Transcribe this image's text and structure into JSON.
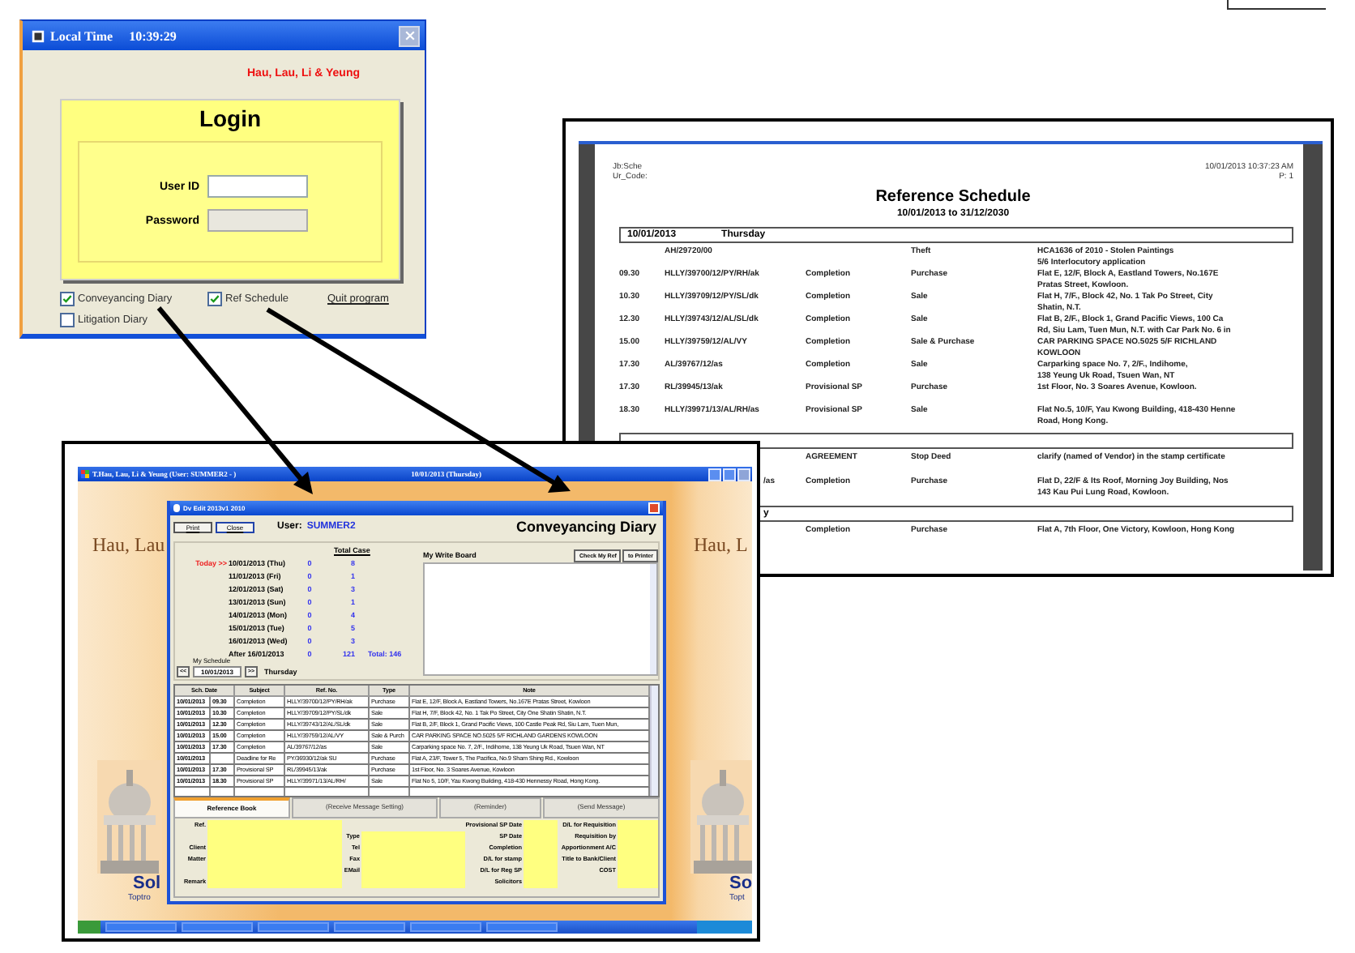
{
  "login_window": {
    "title": "Local Time",
    "time": "10:39:29",
    "firm": "Hau, Lau, Li & Yeung",
    "heading": "Login",
    "fields": [
      {
        "label": "User ID",
        "disabled": false
      },
      {
        "label": "Password",
        "disabled": true
      }
    ],
    "options": [
      {
        "label": "Conveyancing Diary",
        "checked": true
      },
      {
        "label": "Ref Schedule",
        "checked": true
      },
      {
        "label": "Litigation Diary",
        "checked": false
      }
    ],
    "quit_link": "Quit program"
  },
  "report": {
    "header_left": [
      "Jb:Sche",
      "Ur_Code:"
    ],
    "header_right": [
      "10/01/2013 10:37:23 AM",
      "P:   1"
    ],
    "title": "Reference Schedule",
    "range": "10/01/2013  to  31/12/2030",
    "groups": [
      {
        "kind": "header",
        "date": "10/01/2013",
        "day": "Thursday",
        "rows": [
          {
            "kind": "entry",
            "ref": "AH/29720/00",
            "type": "Theft",
            "note_lines": [
              "HCA1636 of 2010 - Stolen Paintings",
              "5/6  Interlocutory application"
            ]
          },
          {
            "kind": "entry",
            "time": "09.30",
            "ref": "HLLY/39700/12/PY/RH/ak",
            "subject": "Completion",
            "type": "Purchase",
            "note_lines": [
              "Flat E, 12/F, Block A, Eastland Towers, No.167E",
              "Pratas Street, Kowloon."
            ]
          },
          {
            "kind": "entry",
            "time": "10.30",
            "ref": "HLLY/39709/12/PY/SL/dk",
            "subject": "Completion",
            "type": "Sale",
            "note_lines": [
              "Flat H, 7/F., Block 42, No. 1 Tak Po Street, City",
              "Shatin, N.T."
            ]
          },
          {
            "kind": "entry",
            "time": "12.30",
            "ref": "HLLY/39743/12/AL/SL/dk",
            "subject": "Completion",
            "type": "Sale",
            "note_lines": [
              "Flat B, 2/F., Block 1, Grand Pacific Views, 100 Ca",
              "Rd, Siu Lam, Tuen Mun, N.T. with Car Park No. 6 in"
            ]
          },
          {
            "kind": "entry",
            "time": "15.00",
            "ref": "HLLY/39759/12/AL/VY",
            "subject": "Completion",
            "type": "Sale & Purchase",
            "note_lines": [
              "CAR PARKING SPACE NO.5025 5/F RICHLAND",
              "KOWLOON"
            ]
          },
          {
            "kind": "entry",
            "time": "17.30",
            "ref": "AL/39767/12/as",
            "subject": "Completion",
            "type": "Sale",
            "note_lines": [
              "Carparking space No. 7, 2/F., Indihome,",
              "138 Yeung Uk Road, Tsuen Wan, NT"
            ]
          },
          {
            "kind": "entry",
            "time": "17.30",
            "ref": "RL/39945/13/ak",
            "subject": "Provisional SP",
            "type": "Purchase",
            "note_lines": [
              "1st Floor, No. 3 Soares Avenue, Kowloon."
            ]
          },
          {
            "kind": "entry",
            "time": "18.30",
            "ref": "HLLY/39971/13/AL/RH/as",
            "subject": "Provisional SP",
            "type": "Sale",
            "note_lines": [
              "Flat No.5, 10/F, Yau Kwong Building, 418-430 Henne",
              "Road, Hong Kong."
            ]
          }
        ]
      },
      {
        "kind": "covered",
        "rows": [
          {
            "kind": "covered",
            "subject": "AGREEMENT",
            "type": "Stop Deed",
            "note_lines": [
              "clarify (named of Vendor) in the stamp certificate"
            ]
          },
          {
            "kind": "covered",
            "ref": "/as",
            "subject": "Completion",
            "type": "Purchase",
            "note_lines": [
              "Flat D, 22/F & Its Roof, Morning Joy Building, Nos",
              "143 Kau Pui Lung Road, Kowloon."
            ]
          }
        ]
      },
      {
        "kind": "covered",
        "day": "y",
        "rows": [
          {
            "kind": "covered",
            "subject": "Completion",
            "type": "Purchase",
            "note_lines": [
              "Flat A, 7th Floor, One Victory, Kowloon, Hong Kong"
            ]
          }
        ]
      }
    ]
  },
  "desktop": {
    "title": "T.Hau, Lau, Li & Yeung  (User: SUMMER2 - )",
    "date": "10/01/2013  (Thursday)",
    "backdrop": [
      "Hau, Lau",
      "Hau, L"
    ],
    "brands": [
      {
        "name": "Sol",
        "tagline": "Toptro"
      },
      {
        "name": "So",
        "tagline": "Topt"
      }
    ]
  },
  "diary_window": {
    "title": "Dv Edit 2013v1 2010",
    "buttons": [
      "Print",
      "Close"
    ],
    "user_label": "User:",
    "user": "SUMMER2",
    "heading": "Conveyancing Diary",
    "summary_header": "Total Case",
    "today_marker": "Today >>",
    "days": [
      {
        "date": "10/01/2013 (Thu)",
        "count": "0",
        "total": "8",
        "today": true
      },
      {
        "date": "11/01/2013 (Fri)",
        "count": "0",
        "total": "1",
        "today": false
      },
      {
        "date": "12/01/2013 (Sat)",
        "count": "0",
        "total": "3",
        "today": false
      },
      {
        "date": "13/01/2013 (Sun)",
        "count": "0",
        "total": "1",
        "today": false
      },
      {
        "date": "14/01/2013 (Mon)",
        "count": "0",
        "total": "4",
        "today": false
      },
      {
        "date": "15/01/2013 (Tue)",
        "count": "0",
        "total": "5",
        "today": false
      },
      {
        "date": "16/01/2013 (Wed)",
        "count": "0",
        "total": "3",
        "today": false
      },
      {
        "date": "After 16/01/2013",
        "count": "0",
        "total": "121",
        "today": false
      }
    ],
    "grand_total": "Total: 146",
    "schedule_label": "My Schedule",
    "nav": {
      "prev": "<<",
      "date": "10/01/2013",
      "next": ">>",
      "day": "Thursday"
    },
    "board": {
      "title": "My Write Board",
      "buttons": [
        "Check My Ref",
        "to Printer"
      ]
    },
    "table": {
      "columns": [
        "Sch. Date",
        "Subject",
        "Ref. No.",
        "Type",
        "Note"
      ],
      "rows": [
        {
          "date": "10/01/2013",
          "time": "09.30",
          "subject": "Completion",
          "ref": "HLLY/39700/12/PY/RH/ak",
          "type": "Purchase",
          "note": "Flat E, 12/F, Block A, Eastland Towers, No.167E Pratas Street, Kowloon"
        },
        {
          "date": "10/01/2013",
          "time": "10.30",
          "subject": "Completion",
          "ref": "HLLY/39709/12/PY/SL/dk",
          "type": "Sale",
          "note": "Flat H, 7/F, Block 42, No. 1 Tak Po Street, City One Shatin Shatin, N.T."
        },
        {
          "date": "10/01/2013",
          "time": "12.30",
          "subject": "Completion",
          "ref": "HLLY/39743/12/AL/SL/dk",
          "type": "Sale",
          "note": "Flat B, 2/F, Block 1, Grand Pacific Views, 100 Castle Peak Rd, Siu Lam, Tuen Mun,"
        },
        {
          "date": "10/01/2013",
          "time": "15.00",
          "subject": "Completion",
          "ref": "HLLY/39759/12/AL/VY",
          "type": "Sale & Purch",
          "note": "CAR PARKING SPACE NO.5025 5/F RICHLAND GARDENS KOWLOON"
        },
        {
          "date": "10/01/2013",
          "time": "17.30",
          "subject": "Completion",
          "ref": "AL/39767/12/as",
          "type": "Sale",
          "note": "Carparking space No. 7, 2/F., Indihome, 138 Yeung Uk Road, Tsuen Wan, NT"
        },
        {
          "date": "10/01/2013",
          "subject": "Deadline for Re",
          "ref": "PY/36930/12/ak SU",
          "type": "Purchase",
          "note": "Flat A, 23/F, Tower 5, The Pacifica, No.9 Sham Shing Rd., Kowloon"
        },
        {
          "date": "10/01/2013",
          "time": "17.30",
          "subject": "Provisional SP",
          "ref": "RL/39945/13/ak",
          "type": "Purchase",
          "note": "1st Floor, No. 3 Soares Avenue, Kowloon"
        },
        {
          "date": "10/01/2013",
          "time": "18.30",
          "subject": "Provisional SP",
          "ref": "HLLY/39971/13/AL/RH/",
          "type": "Sale",
          "note": "Flat No 5, 10/F, Yau Kwong Building, 418-430 Hennessy Road, Hong Kong."
        }
      ]
    },
    "tabs": [
      {
        "label": "Reference Book",
        "selected": true
      },
      {
        "label": "(Receive Message Setting)",
        "selected": false
      },
      {
        "label": "(Reminder)",
        "selected": false
      },
      {
        "label": "(Send Message)",
        "selected": false
      }
    ],
    "form": [
      [
        {
          "kind": "field",
          "label": "Ref."
        },
        {
          "kind": "blank"
        },
        {
          "kind": "field",
          "label": "Client"
        },
        {
          "kind": "field",
          "label": "Matter"
        },
        {
          "kind": "blank"
        },
        {
          "kind": "field",
          "label": "Remark"
        }
      ],
      [
        {
          "kind": "gap"
        },
        {
          "kind": "field",
          "label": "Type"
        },
        {
          "kind": "field",
          "label": "Tel"
        },
        {
          "kind": "field",
          "label": "Fax"
        },
        {
          "kind": "field",
          "label": "EMail"
        },
        {
          "kind": "blank"
        }
      ],
      [
        {
          "kind": "field",
          "label": "Provisional SP Date"
        },
        {
          "kind": "field",
          "label": "SP Date"
        },
        {
          "kind": "field",
          "label": "Completion"
        },
        {
          "kind": "field",
          "label": "D/L for stamp"
        },
        {
          "kind": "field",
          "label": "D/L for Reg SP"
        },
        {
          "kind": "field",
          "label": "Solicitors"
        }
      ],
      [
        {
          "kind": "field",
          "label": "D/L for Requisition"
        },
        {
          "kind": "field",
          "label": "Requisition by"
        },
        {
          "kind": "field",
          "label": "Apportionment A/C"
        },
        {
          "kind": "field",
          "label": "Title to Bank/Client"
        },
        {
          "kind": "field",
          "label": "COST"
        },
        {
          "kind": "blank"
        }
      ]
    ]
  }
}
